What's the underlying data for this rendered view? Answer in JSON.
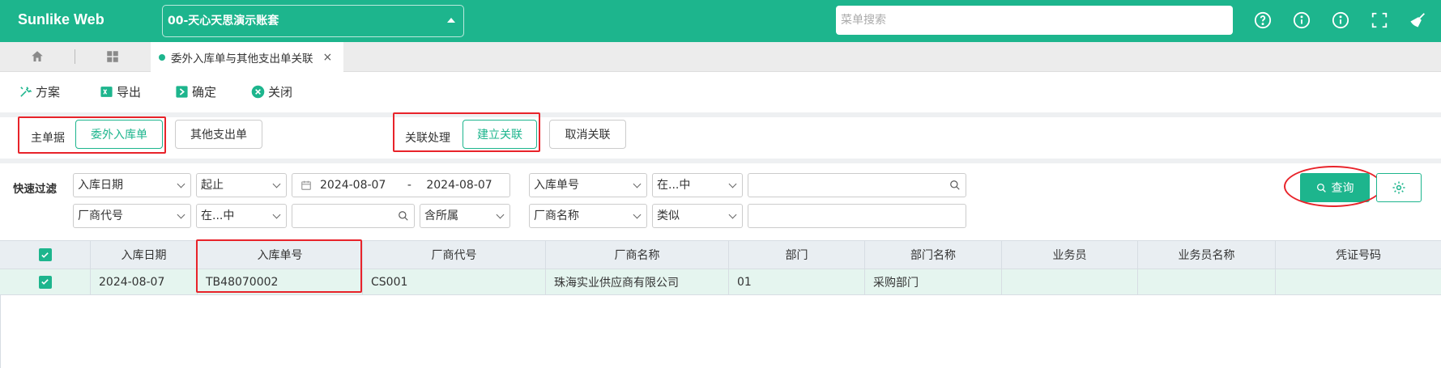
{
  "header": {
    "brand": "Sunlike Web",
    "account": "00-天心天思演示账套",
    "search_placeholder": "菜单搜索"
  },
  "tabs": {
    "active_label": "委外入库单与其他支出单关联",
    "close_symbol": "×"
  },
  "toolbar": {
    "scheme": "方案",
    "export": "导出",
    "confirm": "确定",
    "close": "关闭"
  },
  "master": {
    "label": "主单据",
    "btn_outsourced_receipt": "委外入库单",
    "btn_other_expense": "其他支出单"
  },
  "link": {
    "label": "关联处理",
    "btn_create": "建立关联",
    "btn_cancel": "取消关联"
  },
  "filter": {
    "label": "快速过滤",
    "row1": {
      "field1": "入库日期",
      "op1": "起止",
      "date_from": "2024-08-07",
      "date_sep": "-",
      "date_to": "2024-08-07",
      "field2": "入库单号",
      "op2": "在...中",
      "value2": ""
    },
    "row2": {
      "field1": "厂商代号",
      "op1": "在...中",
      "value1": "",
      "scope": "含所属",
      "field2": "厂商名称",
      "op2": "类似",
      "value2": ""
    },
    "query_btn": "查询"
  },
  "table": {
    "columns": [
      "入库日期",
      "入库单号",
      "厂商代号",
      "厂商名称",
      "部门",
      "部门名称",
      "业务员",
      "业务员名称",
      "凭证号码"
    ],
    "rows": [
      {
        "checked": true,
        "date": "2024-08-07",
        "receipt_no": "TB48070002",
        "vendor_code": "CS001",
        "vendor_name": "珠海实业供应商有限公司",
        "dept": "01",
        "dept_name": "采购部门",
        "salesperson": "",
        "salesperson_name": "",
        "voucher_no": ""
      }
    ]
  },
  "colors": {
    "primary": "#1db58d",
    "highlight_red": "#e8232a"
  }
}
